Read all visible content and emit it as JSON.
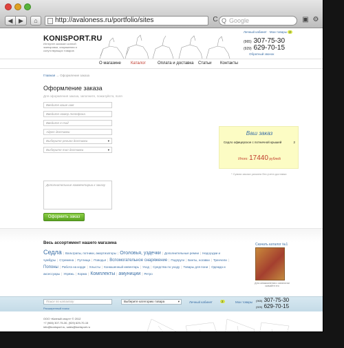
{
  "browser": {
    "back": "◀",
    "forward": "▶",
    "home": "⌂",
    "url": "http://avaloness.ru/portfolio/sites",
    "reload": "C",
    "search_placeholder": "Google",
    "search_glyph": "Q",
    "page_icon": "▣",
    "gear_icon": "⚙"
  },
  "header": {
    "logo": "KONISPORT.RU",
    "tagline": "Интернет-магазин конной экипировки, снаряжения и сопутствующих товаров",
    "cabinet": "Личный кабинет · Мои товары",
    "cart_count": "2",
    "phone1_code": "(965)",
    "phone1": "307-75-30",
    "phone2_code": "(929)",
    "phone2": "629-70-15",
    "callback": "Обратный звонок"
  },
  "menu": [
    "О магазине",
    "Каталог",
    "Оплата и доставка",
    "Статьи",
    "Контакты"
  ],
  "breadcrumb": {
    "home": "Главная",
    "sep": "→",
    "current": "Оформление заказа"
  },
  "form": {
    "title": "Оформление заказа",
    "hint": "Для оформления заказа, заполните, пожалуйста, поля",
    "fields": [
      "Введите ваше имя",
      "Введите номер телефона",
      "Введите e-mail",
      "Адрес доставки",
      "Выберите регион доставки",
      "Выберите тип доставки"
    ],
    "select_arrow": "▾",
    "comment_placeholder": "Дополнительные комментарии к заказу",
    "submit": "Оформить заказ"
  },
  "order": {
    "title": "Ваш заказ",
    "item": "Седло офицерское с потничной крышей",
    "qty": "2",
    "total_label": "Итого:",
    "total_value": "17440",
    "currency": "рублей",
    "note": "* Сумма заказа указана без учета доставки"
  },
  "catalog": {
    "title": "Весь ассортимент нашего магазина",
    "tags": [
      {
        "t": "Седла",
        "s": "big"
      },
      {
        "t": "Вальтрапы, потники, амортизаторы",
        "s": ""
      },
      {
        "t": "Оголовья, уздечки",
        "s": "med"
      },
      {
        "t": "Дополнительные ремни",
        "s": ""
      },
      {
        "t": "Недоуздки и чумбуры",
        "s": ""
      },
      {
        "t": "Стремена",
        "s": ""
      },
      {
        "t": "Путлища",
        "s": ""
      },
      {
        "t": "Поводья",
        "s": ""
      },
      {
        "t": "Вспомогательное снаряжение",
        "s": "med2"
      },
      {
        "t": "Подпруги",
        "s": ""
      },
      {
        "t": "Бинты, ногавки",
        "s": ""
      },
      {
        "t": "Тренчели",
        "s": ""
      },
      {
        "t": "Попоны",
        "s": "med2"
      },
      {
        "t": "Работа на корде",
        "s": ""
      },
      {
        "t": "Хлысты",
        "s": ""
      },
      {
        "t": "Конюшенный инвентарь",
        "s": ""
      },
      {
        "t": "Уход",
        "s": ""
      },
      {
        "t": "Средства по уходу",
        "s": ""
      },
      {
        "t": "Товары для пони",
        "s": ""
      },
      {
        "t": "Одежда и аксессуары",
        "s": ""
      },
      {
        "t": "Упряжь",
        "s": ""
      },
      {
        "t": "Корма",
        "s": ""
      },
      {
        "t": "Комплекты",
        "s": "med"
      },
      {
        "t": "амуниции",
        "s": "med"
      },
      {
        "t": "Ретро",
        "s": ""
      }
    ],
    "download": "Скачать каталог №1",
    "download_caption": "Для ознакомления с каталогом скачайте его"
  },
  "footer": {
    "search_placeholder": "Поиск по каталогу",
    "advanced": "Расширенный поиск",
    "category": "Выберите категорию товара",
    "select_arrow": "▾",
    "cabinet": "Личный кабинет",
    "cart_count": "2",
    "goods": "Мои товары",
    "phone1_code": "(965)",
    "phone1": "307-75-30",
    "phone2_code": "(929)",
    "phone2": "629-70-15",
    "copyright": "ООО «Конный спорт» © 2012",
    "phones_line": "+7 (965) 307-75-30, (929) 629-70-15",
    "emails": "info@konisport.ru, sales@konisport.ru",
    "socials": [
      "f",
      "B",
      "t"
    ]
  },
  "colors": {
    "link": "#3a6ea5",
    "accent_red": "#c0392b",
    "button_green": "#5aa221",
    "order_bg": "#fcfcc4",
    "footer_bg": "#c4dbe7"
  }
}
